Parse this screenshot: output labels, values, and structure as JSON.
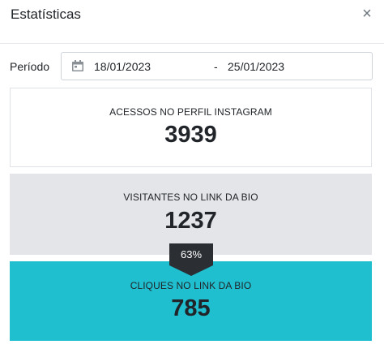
{
  "header": {
    "title": "Estatísticas",
    "close_icon": "×"
  },
  "period": {
    "label": "Período",
    "calendar_icon": "calendar-icon",
    "start_date": "18/01/2023",
    "separator": "-",
    "end_date": "25/01/2023"
  },
  "stats": [
    {
      "label": "ACESSOS NO PERFIL INSTAGRAM",
      "value": "3939",
      "color": "#ffffff"
    },
    {
      "label": "VISITANTES NO LINK DA BIO",
      "value": "1237",
      "color": "#e3e5e8"
    },
    {
      "label": "CLIQUES NO LINK DA BIO",
      "value": "785",
      "color": "#1fbfd0"
    }
  ],
  "conversion_badge": {
    "text": "63%",
    "color": "#2b2f33"
  }
}
